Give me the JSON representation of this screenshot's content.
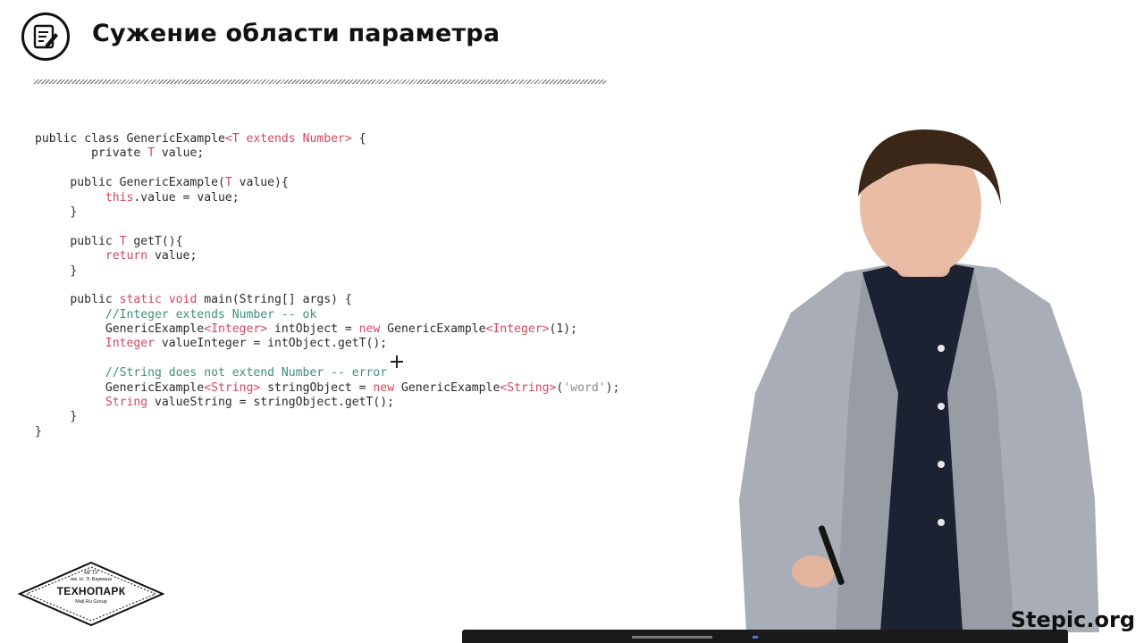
{
  "slide": {
    "title": "Сужение области параметра",
    "icon": "notepad-pencil-icon"
  },
  "code_lines": [
    [
      [
        "public class GenericExample",
        ""
      ],
      [
        "<T extends Number>",
        "kw"
      ],
      [
        " {",
        ""
      ]
    ],
    [
      [
        "        private ",
        ""
      ],
      [
        "T",
        "kw"
      ],
      [
        " value;",
        ""
      ]
    ],
    [],
    [
      [
        "     public GenericExample(",
        ""
      ],
      [
        "T",
        "kw"
      ],
      [
        " value){",
        ""
      ]
    ],
    [
      [
        "          this",
        "kw"
      ],
      [
        ".value = value;",
        ""
      ]
    ],
    [
      [
        "     }",
        ""
      ]
    ],
    [],
    [
      [
        "     public ",
        ""
      ],
      [
        "T",
        "kw"
      ],
      [
        " getT(){",
        ""
      ]
    ],
    [
      [
        "          return",
        "kw"
      ],
      [
        " value;",
        ""
      ]
    ],
    [
      [
        "     }",
        ""
      ]
    ],
    [],
    [
      [
        "     public ",
        ""
      ],
      [
        "static void",
        "kw"
      ],
      [
        " main(String[] args) {",
        ""
      ]
    ],
    [
      [
        "          //Integer extends Number -- ok",
        "cm"
      ]
    ],
    [
      [
        "          GenericExample",
        ""
      ],
      [
        "<Integer>",
        "kw"
      ],
      [
        " intObject = ",
        ""
      ],
      [
        "new",
        "kw"
      ],
      [
        " GenericExample",
        ""
      ],
      [
        "<Integer>",
        "kw"
      ],
      [
        "(1);",
        ""
      ]
    ],
    [
      [
        "          Integer",
        "kw"
      ],
      [
        " valueInteger = intObject.getT();",
        ""
      ]
    ],
    [],
    [
      [
        "          //String does not extend Number -- error",
        "cm"
      ]
    ],
    [
      [
        "          GenericExample",
        ""
      ],
      [
        "<String>",
        "kw"
      ],
      [
        " stringObject = ",
        ""
      ],
      [
        "new",
        "kw"
      ],
      [
        " GenericExample",
        ""
      ],
      [
        "<String>",
        "kw"
      ],
      [
        "(",
        ""
      ],
      [
        "'word'",
        "st"
      ],
      [
        ");",
        ""
      ]
    ],
    [
      [
        "          String",
        "kw"
      ],
      [
        " valueString = stringObject.getT();",
        ""
      ]
    ],
    [
      [
        "     }",
        ""
      ]
    ],
    [
      [
        "}",
        ""
      ]
    ]
  ],
  "logo": {
    "line1": "МГТУ",
    "line2": "им. Н. Э. Баумана",
    "name": "ТЕХНОПАРК",
    "line4": "Mail.Ru Group"
  },
  "brand": "Stepic.org",
  "colors": {
    "keyword": "#d2475f",
    "comment": "#3f8f7a",
    "text": "#2a2a2a",
    "jacket": "#a9adb5",
    "shirt": "#1d2233"
  }
}
